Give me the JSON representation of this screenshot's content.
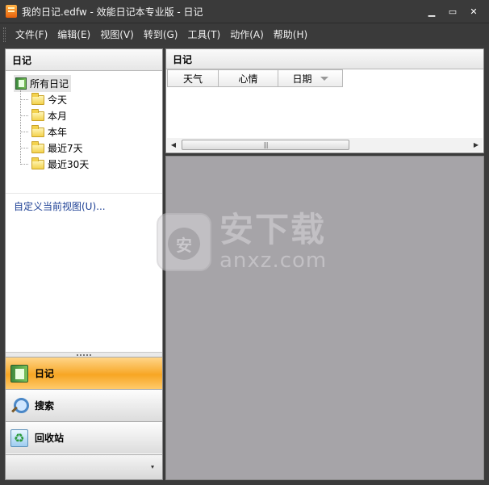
{
  "window": {
    "title": "我的日记.edfw - 效能日记本专业版 - 日记",
    "buttons": {
      "minimize": "▁",
      "maximize": "▭",
      "close": "✕"
    }
  },
  "menu": [
    "文件(F)",
    "编辑(E)",
    "视图(V)",
    "转到(G)",
    "工具(T)",
    "动作(A)",
    "帮助(H)"
  ],
  "left_pane": {
    "header": "日记",
    "tree_root": "所有日记",
    "tree_items": [
      "今天",
      "本月",
      "本年",
      "最近7天",
      "最近30天"
    ],
    "customize_link": "自定义当前视图(U)...",
    "nav_buttons": [
      {
        "label": "日记",
        "icon": "diary-icon",
        "active": true
      },
      {
        "label": "搜索",
        "icon": "search-icon",
        "active": false
      },
      {
        "label": "回收站",
        "icon": "recycle-bin-icon",
        "active": false
      }
    ],
    "footer_caret": "▾"
  },
  "right_pane": {
    "header": "日记",
    "columns": [
      "天气",
      "心情",
      "日期"
    ],
    "scroll_left": "◀",
    "scroll_right": "▶",
    "scroll_thumb": "|||"
  },
  "watermark": {
    "shield_text": "安",
    "text": "安下载",
    "subtext": "anxz.com"
  },
  "colors": {
    "titlebar": "#3a3a3a",
    "active_nav": "#f7a624",
    "preview_bg": "#a6a4a8",
    "link": "#1c3f94"
  }
}
